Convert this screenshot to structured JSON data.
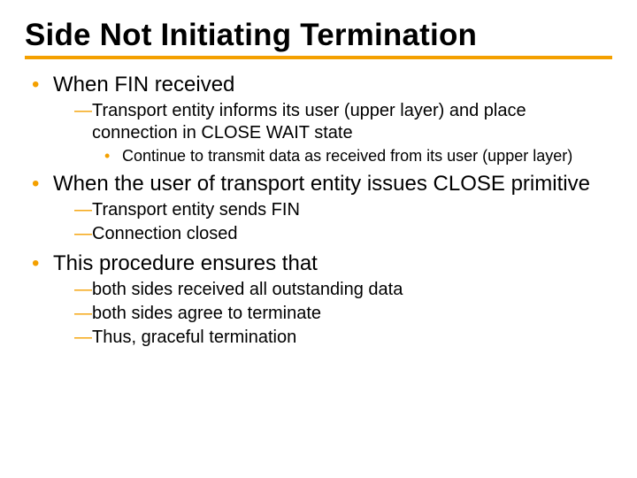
{
  "title": "Side Not Initiating Termination",
  "b1": {
    "text": "When FIN received",
    "s1": "Transport entity informs its user (upper layer) and place connection in CLOSE WAIT state",
    "s1a": "Continue to transmit data as received from its user (upper layer)"
  },
  "b2": {
    "text": "When the user of transport entity issues CLOSE primitive",
    "s1": "Transport entity sends FIN",
    "s2": "Connection closed"
  },
  "b3": {
    "text": "This procedure ensures that",
    "s1": "both sides received all outstanding data",
    "s2": "both sides agree to terminate",
    "s3": "Thus, graceful termination"
  }
}
